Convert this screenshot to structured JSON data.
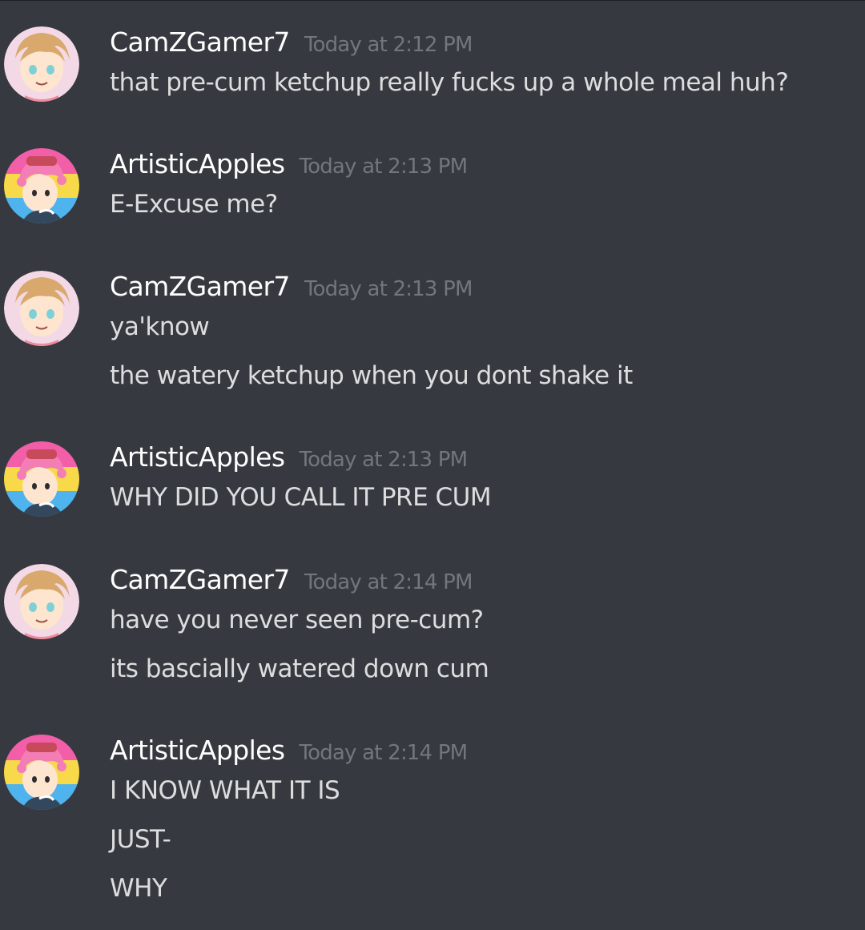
{
  "messages": [
    {
      "username": "CamZGamer7",
      "timestamp": "Today at 2:12 PM",
      "avatar": "camz-avatar-icon",
      "lines": [
        "that pre-cum ketchup really fucks up a whole meal huh?"
      ]
    },
    {
      "username": "ArtisticApples",
      "timestamp": "Today at 2:13 PM",
      "avatar": "artistic-avatar-icon",
      "lines": [
        "E-Excuse me?"
      ]
    },
    {
      "username": "CamZGamer7",
      "timestamp": "Today at 2:13 PM",
      "avatar": "camz-avatar-icon",
      "lines": [
        "ya'know",
        "the watery ketchup when you dont shake it"
      ]
    },
    {
      "username": "ArtisticApples",
      "timestamp": "Today at 2:13 PM",
      "avatar": "artistic-avatar-icon",
      "lines": [
        "WHY DID YOU CALL IT PRE CUM"
      ]
    },
    {
      "username": "CamZGamer7",
      "timestamp": "Today at 2:14 PM",
      "avatar": "camz-avatar-icon",
      "lines": [
        "have you never seen pre-cum?",
        "its bascially watered down cum"
      ]
    },
    {
      "username": "ArtisticApples",
      "timestamp": "Today at 2:14 PM",
      "avatar": "artistic-avatar-icon",
      "lines": [
        "I KNOW WHAT IT IS",
        "JUST-",
        "WHY"
      ]
    }
  ],
  "colors": {
    "background": "#36393f",
    "username": "#ffffff",
    "timestamp": "#72767d",
    "message_text": "#dcddde"
  }
}
